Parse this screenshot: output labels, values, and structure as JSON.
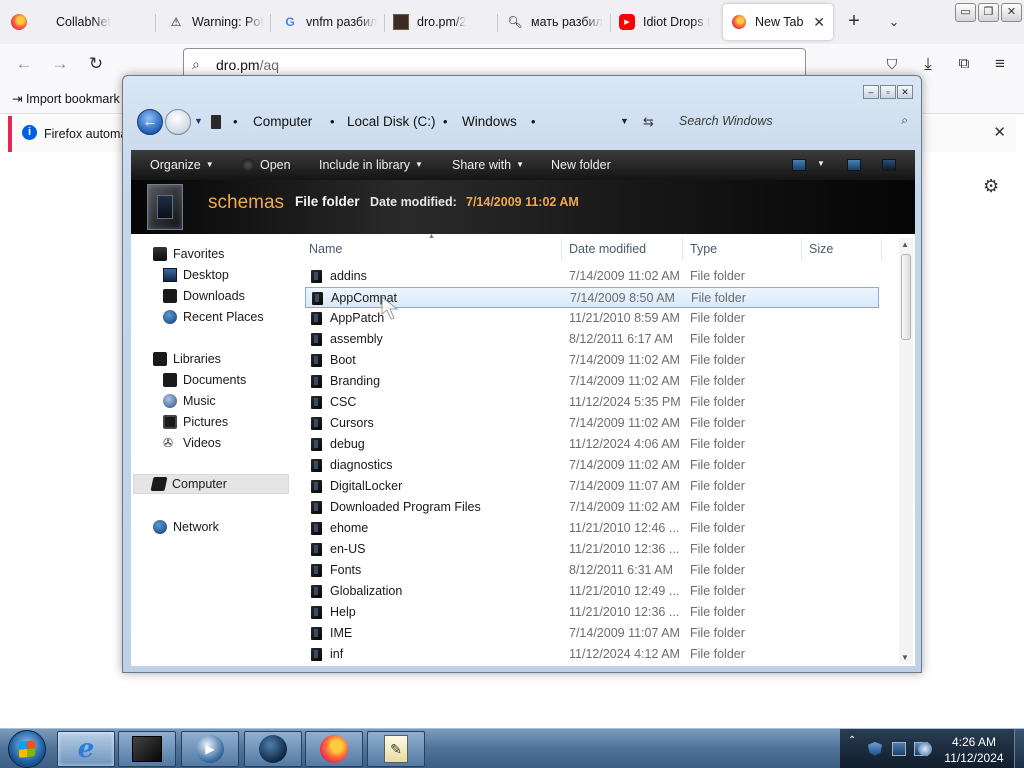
{
  "browser": {
    "tabs": [
      {
        "label": "CollabNet",
        "icon": "firefox-icon"
      },
      {
        "label": "Warning: Pot",
        "icon": "warning-icon"
      },
      {
        "label": "vnfm разбил",
        "icon": "google-icon"
      },
      {
        "label": "dro.pm/2",
        "icon": "image-icon"
      },
      {
        "label": "мать разбил",
        "icon": "search-icon"
      },
      {
        "label": "Idiot Drops I",
        "icon": "youtube-icon"
      },
      {
        "label": "New Tab",
        "icon": "firefox-icon",
        "active": true
      }
    ],
    "window_controls": {
      "minimize": "▭",
      "maximize": "❐",
      "close": "✕"
    },
    "url": {
      "host": "dro.pm",
      "path": "/aq"
    },
    "bookmarks_import": "Import bookmark",
    "infobar_text": "Firefox automa"
  },
  "explorer": {
    "breadcrumb": [
      "Computer",
      "Local Disk (C:)",
      "Windows"
    ],
    "search_placeholder": "Search Windows",
    "toolbar": {
      "organize": "Organize",
      "open": "Open",
      "include": "Include in library",
      "share": "Share with",
      "new_folder": "New folder"
    },
    "details": {
      "name": "schemas",
      "type": "File folder",
      "date_label": "Date modified:",
      "date_value": "7/14/2009 11:02 AM"
    },
    "nav": {
      "favorites": "Favorites",
      "desktop": "Desktop",
      "downloads": "Downloads",
      "recent": "Recent Places",
      "libraries": "Libraries",
      "documents": "Documents",
      "music": "Music",
      "pictures": "Pictures",
      "videos": "Videos",
      "computer": "Computer",
      "network": "Network"
    },
    "columns": {
      "name": "Name",
      "date": "Date modified",
      "type": "Type",
      "size": "Size"
    },
    "files": [
      {
        "name": "addins",
        "date": "7/14/2009 11:02 AM",
        "type": "File folder"
      },
      {
        "name": "AppCompat",
        "date": "7/14/2009 8:50 AM",
        "type": "File folder"
      },
      {
        "name": "AppPatch",
        "date": "11/21/2010 8:59 AM",
        "type": "File folder"
      },
      {
        "name": "assembly",
        "date": "8/12/2011 6:17 AM",
        "type": "File folder"
      },
      {
        "name": "Boot",
        "date": "7/14/2009 11:02 AM",
        "type": "File folder"
      },
      {
        "name": "Branding",
        "date": "7/14/2009 11:02 AM",
        "type": "File folder"
      },
      {
        "name": "CSC",
        "date": "11/12/2024 5:35 PM",
        "type": "File folder"
      },
      {
        "name": "Cursors",
        "date": "7/14/2009 11:02 AM",
        "type": "File folder"
      },
      {
        "name": "debug",
        "date": "11/12/2024 4:06 AM",
        "type": "File folder"
      },
      {
        "name": "diagnostics",
        "date": "7/14/2009 11:02 AM",
        "type": "File folder"
      },
      {
        "name": "DigitalLocker",
        "date": "7/14/2009 11:07 AM",
        "type": "File folder"
      },
      {
        "name": "Downloaded Program Files",
        "date": "7/14/2009 11:02 AM",
        "type": "File folder"
      },
      {
        "name": "ehome",
        "date": "11/21/2010 12:46 ...",
        "type": "File folder"
      },
      {
        "name": "en-US",
        "date": "11/21/2010 12:36 ...",
        "type": "File folder"
      },
      {
        "name": "Fonts",
        "date": "8/12/2011 6:31 AM",
        "type": "File folder"
      },
      {
        "name": "Globalization",
        "date": "11/21/2010 12:49 ...",
        "type": "File folder"
      },
      {
        "name": "Help",
        "date": "11/21/2010 12:36 ...",
        "type": "File folder"
      },
      {
        "name": "IME",
        "date": "7/14/2009 11:07 AM",
        "type": "File folder"
      },
      {
        "name": "inf",
        "date": "11/12/2024 4:12 AM",
        "type": "File folder"
      }
    ],
    "selected_file": "AppCompat"
  },
  "taskbar": {
    "clock_time": "4:26 AM",
    "clock_date": "11/12/2024"
  }
}
